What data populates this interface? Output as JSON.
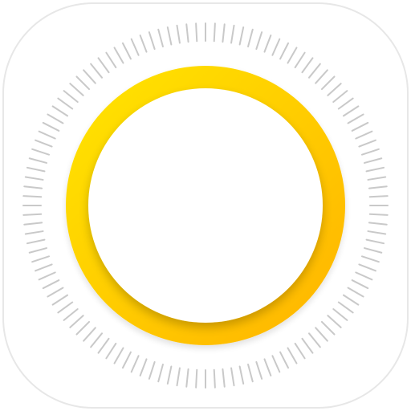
{
  "icon": {
    "name": "dial-ring-icon",
    "colors": {
      "background": "#ffffff",
      "tile": "#ffffff",
      "tile_border": "#e7e7e7",
      "tick": "#c9c9c9",
      "ring_light": "#ffe600",
      "ring_dark": "#ffb300",
      "inner": "#ffffff"
    },
    "tick_count": 120
  }
}
